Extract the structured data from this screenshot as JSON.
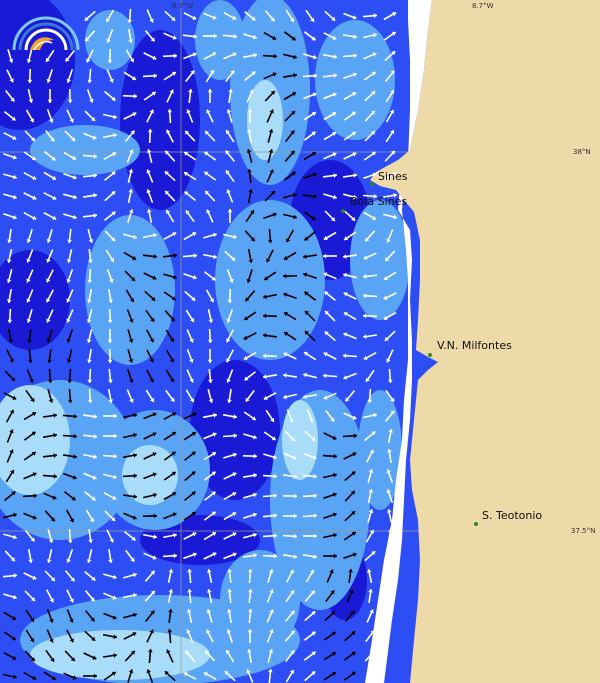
{
  "map": {
    "colors": {
      "land": "#eed9a8",
      "coast_white": "#ffffff",
      "sea_dark": "#1a1ad6",
      "sea_mid": "#2e4ef5",
      "sea_light": "#5aa4f5",
      "sea_pale": "#a8dcf8",
      "grid": "#9a9a9a",
      "arrow_light": "#ffffff",
      "arrow_dark": "#000000",
      "place_dot": "#2a8a2a"
    },
    "graticule": {
      "lon_labels": [
        "8.7°W",
        "8.7°W"
      ],
      "lat_labels": [
        "38°N",
        "37.5°N"
      ]
    },
    "places": [
      {
        "name": "Sines",
        "dot": true
      },
      {
        "name": "Boia Sines",
        "dot": true
      },
      {
        "name": "V.N. Milfontes",
        "dot": true
      },
      {
        "name": "S. Teotonio",
        "dot": true
      }
    ],
    "logo_icon": "wave-gauge-icon"
  }
}
